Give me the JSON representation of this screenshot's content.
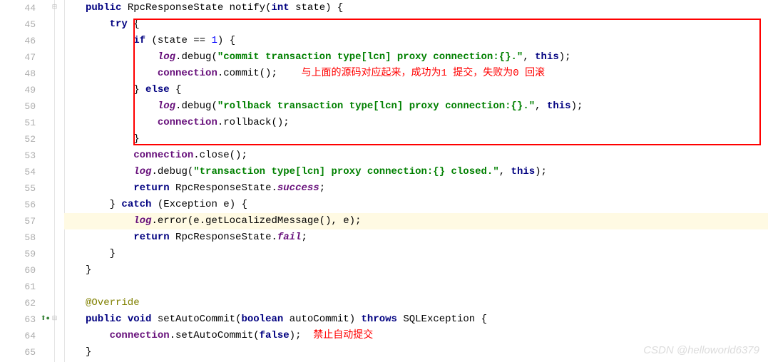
{
  "gutter": {
    "start": 44,
    "end": 65
  },
  "line44": {
    "kw1": "public",
    "type": "RpcResponseState",
    "name": "notify",
    "kw2": "int",
    "param": "state"
  },
  "line45": {
    "kw": "try"
  },
  "line46": {
    "kw": "if",
    "var": "state",
    "num": "1"
  },
  "line47": {
    "field": "log",
    "method": ".debug(",
    "str": "\"commit transaction type[lcn] proxy connection:{}.\"",
    "this": "this",
    "end": ");"
  },
  "line48": {
    "field": "connection",
    "call": ".commit();"
  },
  "line48_note": "与上面的源码对应起来，成功为1 提交，失败为0 回滚",
  "line49": {
    "else": "else"
  },
  "line50": {
    "field": "log",
    "method": ".debug(",
    "str": "\"rollback transaction type[lcn] proxy connection:{}.\"",
    "this": "this",
    "end": ");"
  },
  "line51": {
    "field": "connection",
    "call": ".rollback();"
  },
  "line53": {
    "field": "connection",
    "call": ".close();"
  },
  "line54": {
    "field": "log",
    "method": ".debug(",
    "str": "\"transaction type[lcn] proxy connection:{} closed.\"",
    "this": "this",
    "end": ");"
  },
  "line55": {
    "kw": "return",
    "type": "RpcResponseState.",
    "val": "success"
  },
  "line56": {
    "kw": "catch",
    "type": "Exception",
    "var": "e"
  },
  "line57": {
    "field": "log",
    "call": ".error(e.getLocalizedMessage(), e);"
  },
  "line58": {
    "kw": "return",
    "type": "RpcResponseState.",
    "val": "fail"
  },
  "line62": {
    "anno": "@Override"
  },
  "line63": {
    "kw1": "public",
    "kw2": "void",
    "name": "setAutoCommit",
    "kw3": "boolean",
    "param": "autoCommit",
    "kw4": "throws",
    "ex": "SQLException"
  },
  "line64": {
    "field": "connection",
    "call": ".setAutoCommit(",
    "kw": "false",
    "end": ");"
  },
  "line64_note": "禁止自动提交",
  "watermark": "CSDN @helloworld6379"
}
